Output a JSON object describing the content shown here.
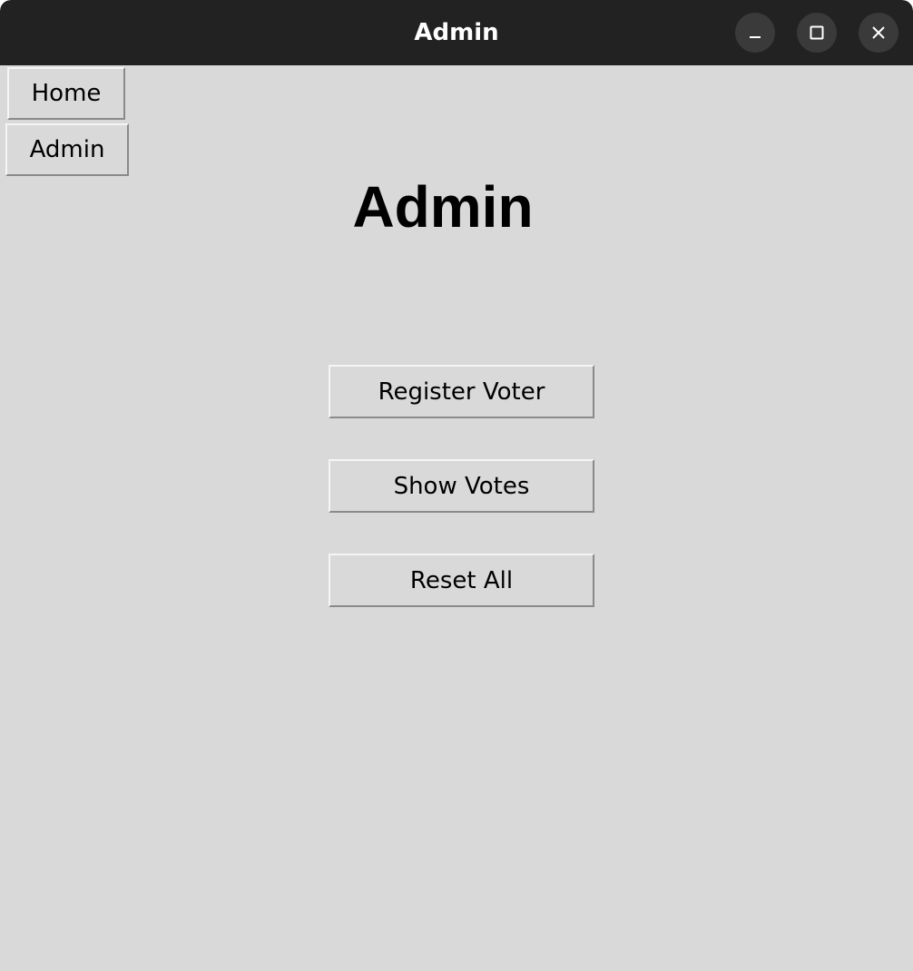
{
  "window": {
    "title": "Admin",
    "controls": {
      "minimize": "minimize-icon",
      "maximize": "maximize-icon",
      "close": "close-icon"
    }
  },
  "nav": {
    "home_label": "Home",
    "admin_label": "Admin"
  },
  "main": {
    "heading": "Admin",
    "actions": {
      "register_voter": "Register Voter",
      "show_votes": "Show Votes",
      "reset_all": "Reset All"
    }
  },
  "colors": {
    "titlebar": "#222222",
    "background": "#d9d9d9",
    "button_face": "#d9d9d9",
    "text": "#000000"
  }
}
